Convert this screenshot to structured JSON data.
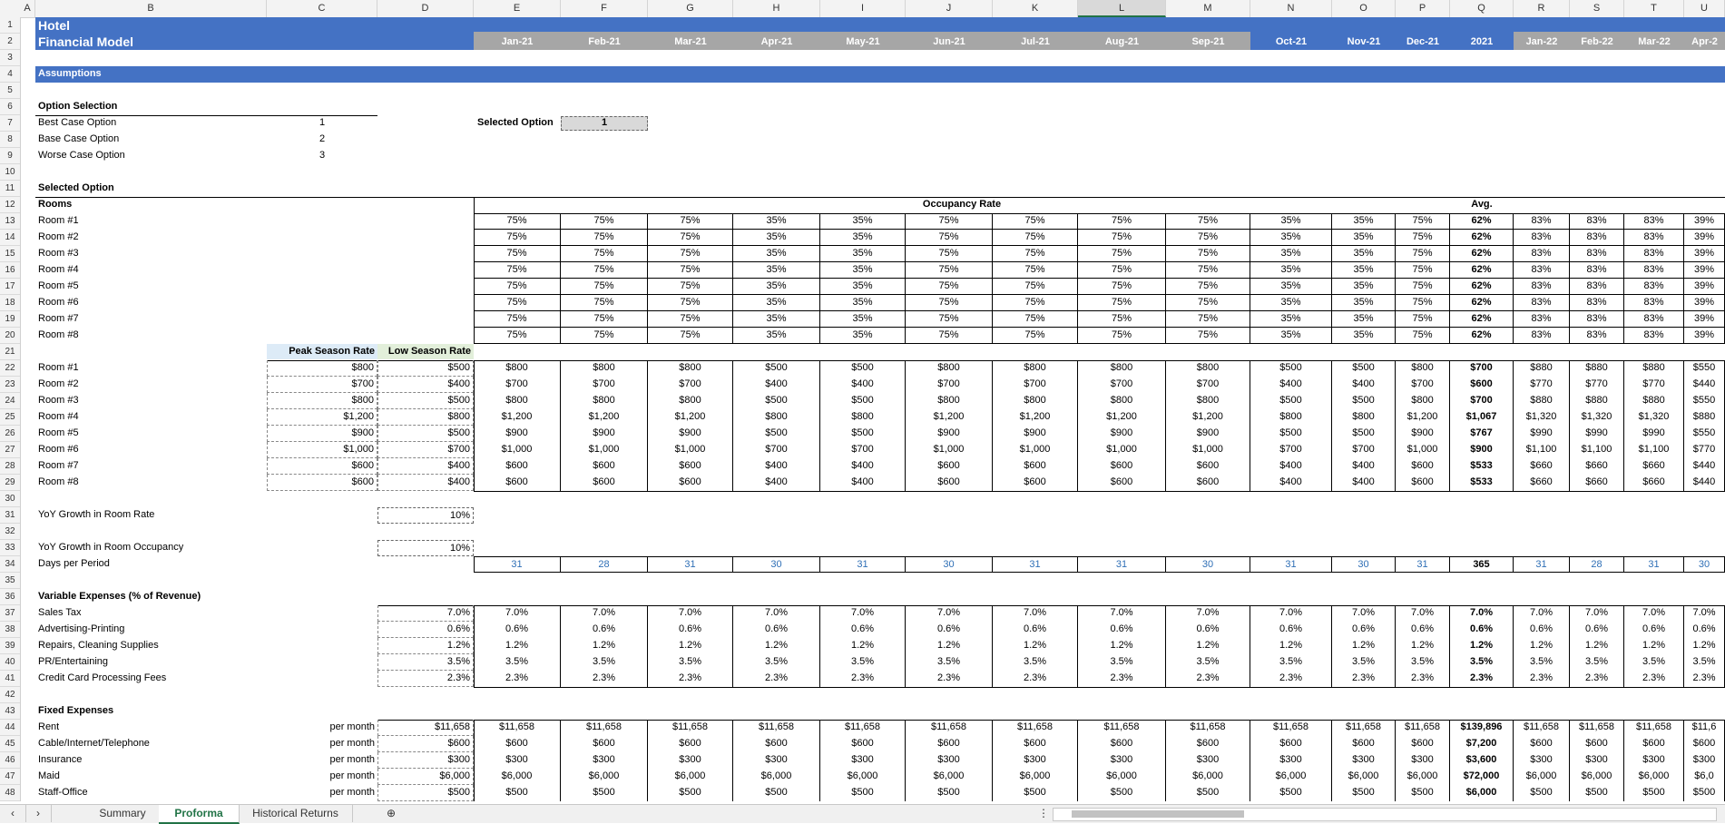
{
  "columns": [
    "A",
    "B",
    "C",
    "D",
    "E",
    "F",
    "G",
    "H",
    "I",
    "J",
    "K",
    "L",
    "M",
    "N",
    "O",
    "P",
    "Q",
    "R",
    "S",
    "T",
    "U"
  ],
  "rows": [
    "1",
    "2",
    "3",
    "4",
    "5",
    "6",
    "7",
    "8",
    "9",
    "10",
    "11",
    "12",
    "13",
    "14",
    "15",
    "16",
    "17",
    "18",
    "19",
    "20",
    "21",
    "22",
    "23",
    "24",
    "25",
    "26",
    "27",
    "28",
    "29",
    "30",
    "31",
    "32",
    "33",
    "34",
    "35",
    "36",
    "37",
    "38",
    "39",
    "40",
    "41",
    "42",
    "43",
    "44",
    "45",
    "46",
    "47",
    "48"
  ],
  "title": {
    "line1": "Hotel",
    "line2": "Financial Model"
  },
  "months": [
    "Jan-21",
    "Feb-21",
    "Mar-21",
    "Apr-21",
    "May-21",
    "Jun-21",
    "Jul-21",
    "Aug-21",
    "Sep-21",
    "Oct-21",
    "Nov-21",
    "Dec-21",
    "2021",
    "Jan-22",
    "Feb-22",
    "Mar-22",
    "Apr-2"
  ],
  "assumptions_label": "Assumptions",
  "option_selection": {
    "header": "Option Selection",
    "items": [
      {
        "label": "Best Case Option",
        "value": "1"
      },
      {
        "label": "Base Case Option",
        "value": "2"
      },
      {
        "label": "Worse Case Option",
        "value": "3"
      }
    ]
  },
  "selected_option": {
    "label": "Selected Option",
    "value": "1"
  },
  "selected_option_header": "Selected Option",
  "rooms_header": "Rooms",
  "occupancy_header": "Occupancy Rate",
  "avg_header": "Avg.",
  "rooms": [
    "Room #1",
    "Room #2",
    "Room #3",
    "Room #4",
    "Room #5",
    "Room #6",
    "Room #7",
    "Room #8"
  ],
  "occupancy_row": [
    "75%",
    "75%",
    "75%",
    "35%",
    "35%",
    "75%",
    "75%",
    "75%",
    "75%",
    "35%",
    "35%",
    "75%",
    "62%",
    "83%",
    "83%",
    "83%",
    "39%"
  ],
  "rate_headers": {
    "peak": "Peak Season Rate",
    "low": "Low Season Rate"
  },
  "rates": [
    {
      "peak": "$800",
      "low": "$500",
      "vals": [
        "$800",
        "$800",
        "$800",
        "$500",
        "$500",
        "$800",
        "$800",
        "$800",
        "$800",
        "$500",
        "$500",
        "$800",
        "$700",
        "$880",
        "$880",
        "$880",
        "$550"
      ]
    },
    {
      "peak": "$700",
      "low": "$400",
      "vals": [
        "$700",
        "$700",
        "$700",
        "$400",
        "$400",
        "$700",
        "$700",
        "$700",
        "$700",
        "$400",
        "$400",
        "$700",
        "$600",
        "$770",
        "$770",
        "$770",
        "$440"
      ]
    },
    {
      "peak": "$800",
      "low": "$500",
      "vals": [
        "$800",
        "$800",
        "$800",
        "$500",
        "$500",
        "$800",
        "$800",
        "$800",
        "$800",
        "$500",
        "$500",
        "$800",
        "$700",
        "$880",
        "$880",
        "$880",
        "$550"
      ]
    },
    {
      "peak": "$1,200",
      "low": "$800",
      "vals": [
        "$1,200",
        "$1,200",
        "$1,200",
        "$800",
        "$800",
        "$1,200",
        "$1,200",
        "$1,200",
        "$1,200",
        "$800",
        "$800",
        "$1,200",
        "$1,067",
        "$1,320",
        "$1,320",
        "$1,320",
        "$880"
      ]
    },
    {
      "peak": "$900",
      "low": "$500",
      "vals": [
        "$900",
        "$900",
        "$900",
        "$500",
        "$500",
        "$900",
        "$900",
        "$900",
        "$900",
        "$500",
        "$500",
        "$900",
        "$767",
        "$990",
        "$990",
        "$990",
        "$550"
      ]
    },
    {
      "peak": "$1,000",
      "low": "$700",
      "vals": [
        "$1,000",
        "$1,000",
        "$1,000",
        "$700",
        "$700",
        "$1,000",
        "$1,000",
        "$1,000",
        "$1,000",
        "$700",
        "$700",
        "$1,000",
        "$900",
        "$1,100",
        "$1,100",
        "$1,100",
        "$770"
      ]
    },
    {
      "peak": "$600",
      "low": "$400",
      "vals": [
        "$600",
        "$600",
        "$600",
        "$400",
        "$400",
        "$600",
        "$600",
        "$600",
        "$600",
        "$400",
        "$400",
        "$600",
        "$533",
        "$660",
        "$660",
        "$660",
        "$440"
      ]
    },
    {
      "peak": "$600",
      "low": "$400",
      "vals": [
        "$600",
        "$600",
        "$600",
        "$400",
        "$400",
        "$600",
        "$600",
        "$600",
        "$600",
        "$400",
        "$400",
        "$600",
        "$533",
        "$660",
        "$660",
        "$660",
        "$440"
      ]
    }
  ],
  "yoy_rate": {
    "label": "YoY Growth in Room Rate",
    "value": "10%"
  },
  "yoy_occ": {
    "label": "YoY Growth in Room Occupancy",
    "value": "10%"
  },
  "days": {
    "label": "Days per Period",
    "vals": [
      "31",
      "28",
      "31",
      "30",
      "31",
      "30",
      "31",
      "31",
      "30",
      "31",
      "30",
      "31",
      "365",
      "31",
      "28",
      "31",
      "30"
    ]
  },
  "variable_header": "Variable Expenses (% of Revenue)",
  "variable": [
    {
      "label": "Sales Tax",
      "input": "7.0%",
      "vals": [
        "7.0%",
        "7.0%",
        "7.0%",
        "7.0%",
        "7.0%",
        "7.0%",
        "7.0%",
        "7.0%",
        "7.0%",
        "7.0%",
        "7.0%",
        "7.0%",
        "7.0%",
        "7.0%",
        "7.0%",
        "7.0%",
        "7.0%"
      ]
    },
    {
      "label": "Advertising-Printing",
      "input": "0.6%",
      "vals": [
        "0.6%",
        "0.6%",
        "0.6%",
        "0.6%",
        "0.6%",
        "0.6%",
        "0.6%",
        "0.6%",
        "0.6%",
        "0.6%",
        "0.6%",
        "0.6%",
        "0.6%",
        "0.6%",
        "0.6%",
        "0.6%",
        "0.6%"
      ]
    },
    {
      "label": "Repairs, Cleaning Supplies",
      "input": "1.2%",
      "vals": [
        "1.2%",
        "1.2%",
        "1.2%",
        "1.2%",
        "1.2%",
        "1.2%",
        "1.2%",
        "1.2%",
        "1.2%",
        "1.2%",
        "1.2%",
        "1.2%",
        "1.2%",
        "1.2%",
        "1.2%",
        "1.2%",
        "1.2%"
      ]
    },
    {
      "label": "PR/Entertaining",
      "input": "3.5%",
      "vals": [
        "3.5%",
        "3.5%",
        "3.5%",
        "3.5%",
        "3.5%",
        "3.5%",
        "3.5%",
        "3.5%",
        "3.5%",
        "3.5%",
        "3.5%",
        "3.5%",
        "3.5%",
        "3.5%",
        "3.5%",
        "3.5%",
        "3.5%"
      ]
    },
    {
      "label": "Credit Card Processing Fees",
      "input": "2.3%",
      "vals": [
        "2.3%",
        "2.3%",
        "2.3%",
        "2.3%",
        "2.3%",
        "2.3%",
        "2.3%",
        "2.3%",
        "2.3%",
        "2.3%",
        "2.3%",
        "2.3%",
        "2.3%",
        "2.3%",
        "2.3%",
        "2.3%",
        "2.3%"
      ]
    }
  ],
  "fixed_header": "Fixed Expenses",
  "fixed": [
    {
      "label": "Rent",
      "unit": "per month",
      "input": "$11,658",
      "vals": [
        "$11,658",
        "$11,658",
        "$11,658",
        "$11,658",
        "$11,658",
        "$11,658",
        "$11,658",
        "$11,658",
        "$11,658",
        "$11,658",
        "$11,658",
        "$11,658",
        "$139,896",
        "$11,658",
        "$11,658",
        "$11,658",
        "$11,6"
      ]
    },
    {
      "label": "Cable/Internet/Telephone",
      "unit": "per month",
      "input": "$600",
      "vals": [
        "$600",
        "$600",
        "$600",
        "$600",
        "$600",
        "$600",
        "$600",
        "$600",
        "$600",
        "$600",
        "$600",
        "$600",
        "$7,200",
        "$600",
        "$600",
        "$600",
        "$600"
      ]
    },
    {
      "label": "Insurance",
      "unit": "per month",
      "input": "$300",
      "vals": [
        "$300",
        "$300",
        "$300",
        "$300",
        "$300",
        "$300",
        "$300",
        "$300",
        "$300",
        "$300",
        "$300",
        "$300",
        "$3,600",
        "$300",
        "$300",
        "$300",
        "$300"
      ]
    },
    {
      "label": "Maid",
      "unit": "per month",
      "input": "$6,000",
      "vals": [
        "$6,000",
        "$6,000",
        "$6,000",
        "$6,000",
        "$6,000",
        "$6,000",
        "$6,000",
        "$6,000",
        "$6,000",
        "$6,000",
        "$6,000",
        "$6,000",
        "$72,000",
        "$6,000",
        "$6,000",
        "$6,000",
        "$6,0"
      ]
    },
    {
      "label": "Staff-Office",
      "unit": "per month",
      "input": "$500",
      "vals": [
        "$500",
        "$500",
        "$500",
        "$500",
        "$500",
        "$500",
        "$500",
        "$500",
        "$500",
        "$500",
        "$500",
        "$500",
        "$6,000",
        "$500",
        "$500",
        "$500",
        "$500"
      ]
    }
  ],
  "tabs": [
    "Summary",
    "Proforma",
    "Historical Returns"
  ],
  "active_tab": "Proforma",
  "colors": {
    "header_blue": "#4472c4",
    "green_active": "#217346",
    "peak_fill": "#ddebf7",
    "low_fill": "#e2efda"
  }
}
